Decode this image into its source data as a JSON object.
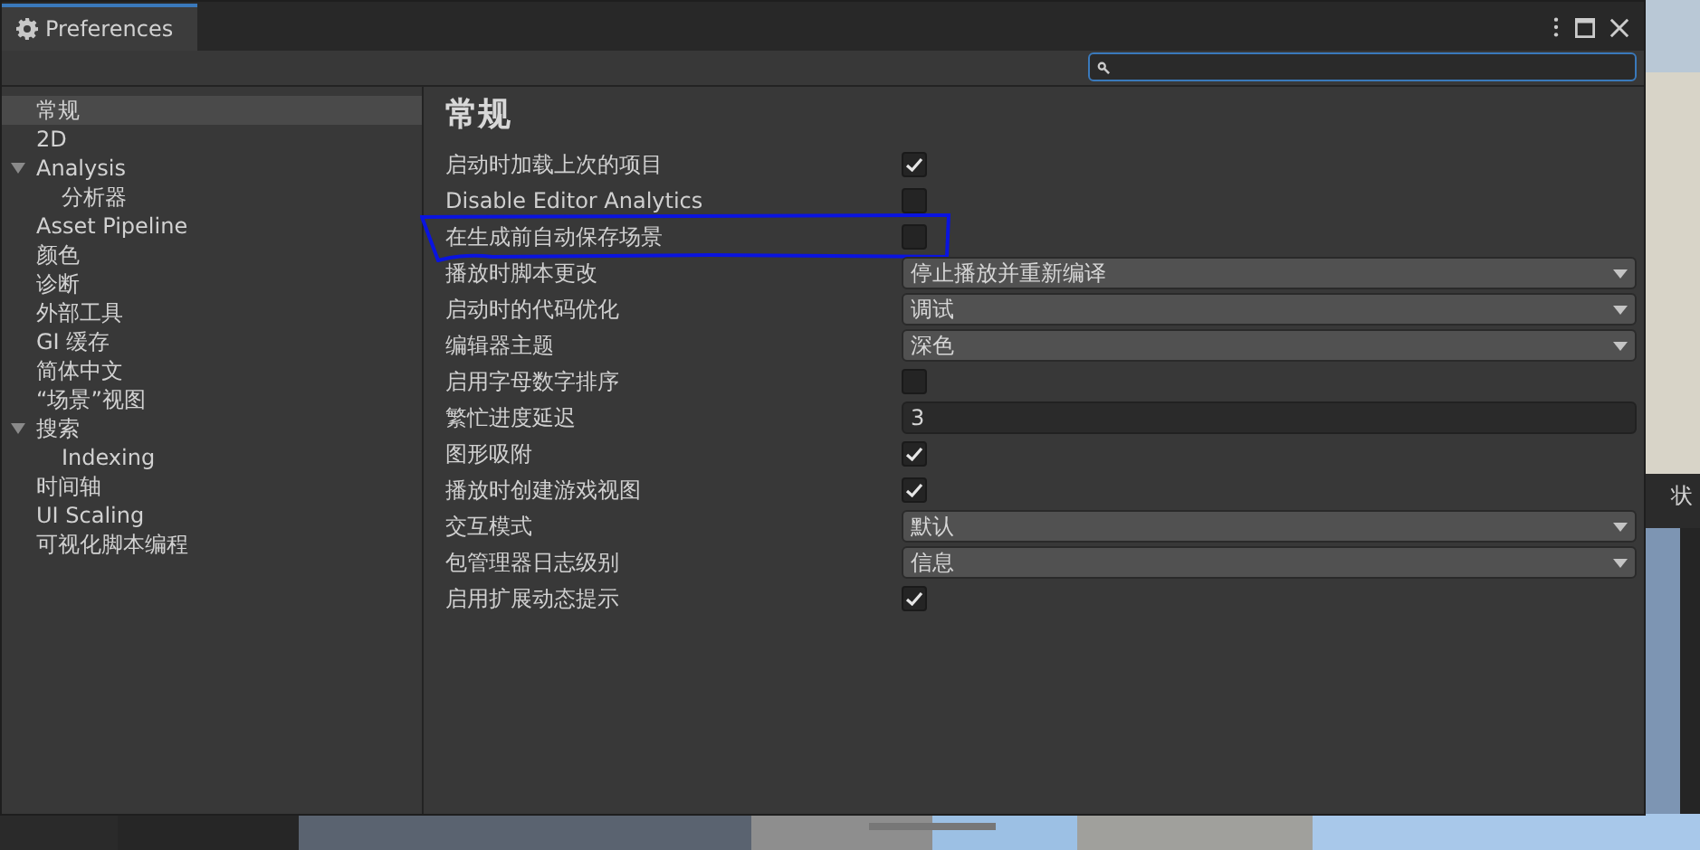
{
  "window": {
    "title": "Preferences"
  },
  "sidebar": {
    "items": [
      {
        "label": "常规",
        "selected": true
      },
      {
        "label": "2D",
        "selected": false
      },
      {
        "label": "Analysis",
        "selected": false,
        "expanded": true,
        "children": [
          {
            "label": "分析器",
            "selected": false
          }
        ]
      },
      {
        "label": "Asset Pipeline",
        "selected": false
      },
      {
        "label": "颜色",
        "selected": false
      },
      {
        "label": "诊断",
        "selected": false
      },
      {
        "label": "外部工具",
        "selected": false
      },
      {
        "label": "GI 缓存",
        "selected": false
      },
      {
        "label": "简体中文",
        "selected": false
      },
      {
        "label": "“场景”视图",
        "selected": false
      },
      {
        "label": "搜索",
        "selected": false,
        "expanded": true,
        "children": [
          {
            "label": "Indexing",
            "selected": false
          }
        ]
      },
      {
        "label": "时间轴",
        "selected": false
      },
      {
        "label": "UI Scaling",
        "selected": false
      },
      {
        "label": "可视化脚本编程",
        "selected": false
      }
    ]
  },
  "page": {
    "heading": "常规",
    "settings": [
      {
        "label": "启动时加载上次的项目",
        "kind": "checkbox",
        "checked": true
      },
      {
        "label": "Disable Editor Analytics",
        "kind": "checkbox",
        "checked": false
      },
      {
        "label": "在生成前自动保存场景",
        "kind": "checkbox",
        "checked": false,
        "highlighted": true
      },
      {
        "label": "播放时脚本更改",
        "kind": "dropdown",
        "value": "停止播放并重新编译"
      },
      {
        "label": "启动时的代码优化",
        "kind": "dropdown",
        "value": "调试"
      },
      {
        "label": "编辑器主题",
        "kind": "dropdown",
        "value": "深色"
      },
      {
        "label": "启用字母数字排序",
        "kind": "checkbox",
        "checked": false
      },
      {
        "label": "繁忙进度延迟",
        "kind": "number",
        "value": "3"
      },
      {
        "label": "图形吸附",
        "kind": "checkbox",
        "checked": true
      },
      {
        "label": "播放时创建游戏视图",
        "kind": "checkbox",
        "checked": true
      },
      {
        "label": "交互模式",
        "kind": "dropdown",
        "value": "默认"
      },
      {
        "label": "包管理器日志级别",
        "kind": "dropdown",
        "value": "信息"
      },
      {
        "label": "启用扩展动态提示",
        "kind": "checkbox",
        "checked": true
      }
    ]
  },
  "background": {
    "tab": "状"
  }
}
